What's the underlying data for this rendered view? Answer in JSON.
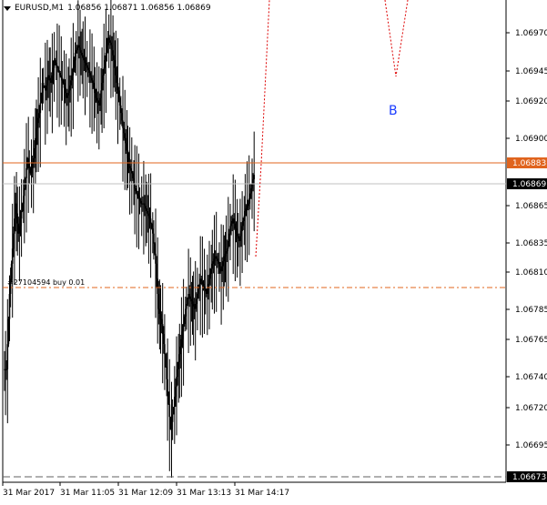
{
  "chart_title": {
    "symbol_tf": "EURUSD,M1",
    "ohlc": "1.06856 1.06871 1.06856 1.06869"
  },
  "colors": {
    "background": "#ffffff",
    "candles": "#000000",
    "orange_level": "#e0641e",
    "order_line": "#e0641e",
    "forecast_path": "#dd0000",
    "wave_label": "#1a3cff",
    "bid_box": "#000000",
    "axis": "#000000"
  },
  "price_scale": {
    "labels": [
      "1.06970",
      "1.06945",
      "1.06920",
      "1.06900",
      "1.06865",
      "1.06835",
      "1.06810",
      "1.06785",
      "1.06765",
      "1.06740",
      "1.06720",
      "1.06695"
    ],
    "orange_level_label": "1.06883",
    "current_bid_label": "1.06869",
    "bottom_dashed_label": "1.06673"
  },
  "time_scale": {
    "labels": [
      "31 Mar 2017",
      "31 Mar 11:05",
      "31 Mar 12:09",
      "31 Mar 13:13",
      "31 Mar 14:17"
    ]
  },
  "order_label": "#27104594 buy 0.01",
  "wave_label": "B",
  "chart_data": {
    "type": "candlestick",
    "symbol": "EURUSD",
    "timeframe": "M1",
    "ylim": [
      1.06665,
      1.06985
    ],
    "x_tick_labels": [
      "31 Mar 2017",
      "31 Mar 11:05",
      "31 Mar 12:09",
      "31 Mar 13:13",
      "31 Mar 14:17"
    ],
    "close_path": [
      1.0674,
      1.0679,
      1.0682,
      1.0685,
      1.0683,
      1.06845,
      1.0686,
      1.0688,
      1.0687,
      1.0688,
      1.069,
      1.0691,
      1.0693,
      1.06925,
      1.06935,
      1.0693,
      1.06945,
      1.0694,
      1.06935,
      1.0693,
      1.0692,
      1.06925,
      1.06935,
      1.0695,
      1.06955,
      1.0695,
      1.06945,
      1.0694,
      1.06935,
      1.0693,
      1.0692,
      1.06915,
      1.0693,
      1.06945,
      1.0696,
      1.06955,
      1.06945,
      1.0693,
      1.06915,
      1.069,
      1.0689,
      1.06875,
      1.0687,
      1.0686,
      1.06855,
      1.0685,
      1.0685,
      1.06845,
      1.0684,
      1.0683,
      1.0681,
      1.0678,
      1.0677,
      1.0675,
      1.06725,
      1.067,
      1.06715,
      1.06735,
      1.0675,
      1.06765,
      1.0678,
      1.0679,
      1.06785,
      1.0678,
      1.0679,
      1.068,
      1.06795,
      1.0679,
      1.068,
      1.0681,
      1.06815,
      1.0681,
      1.06805,
      1.06815,
      1.0682,
      1.06835,
      1.0684,
      1.0683,
      1.06825,
      1.06835,
      1.06845,
      1.0685,
      1.0686,
      1.06869
    ],
    "horizontal_levels": [
      {
        "price": 1.06883,
        "label": "1.06883",
        "style": "solid"
      },
      {
        "price": 1.06869,
        "label": "1.06869",
        "style": "bid"
      },
      {
        "price": 1.06806,
        "label": "#27104594 buy 0.01",
        "style": "dashdot"
      },
      {
        "price": 1.06673,
        "label": "1.06673",
        "style": "dashed"
      }
    ],
    "forecast_path": [
      [
        1.06822,
        0
      ],
      [
        1.06883,
        1
      ],
      [
        1.06985,
        2
      ]
    ],
    "forecast_b": [
      [
        1.06985,
        0
      ],
      [
        1.0694,
        1
      ],
      [
        1.06985,
        2
      ]
    ],
    "annotations": [
      "B"
    ]
  }
}
